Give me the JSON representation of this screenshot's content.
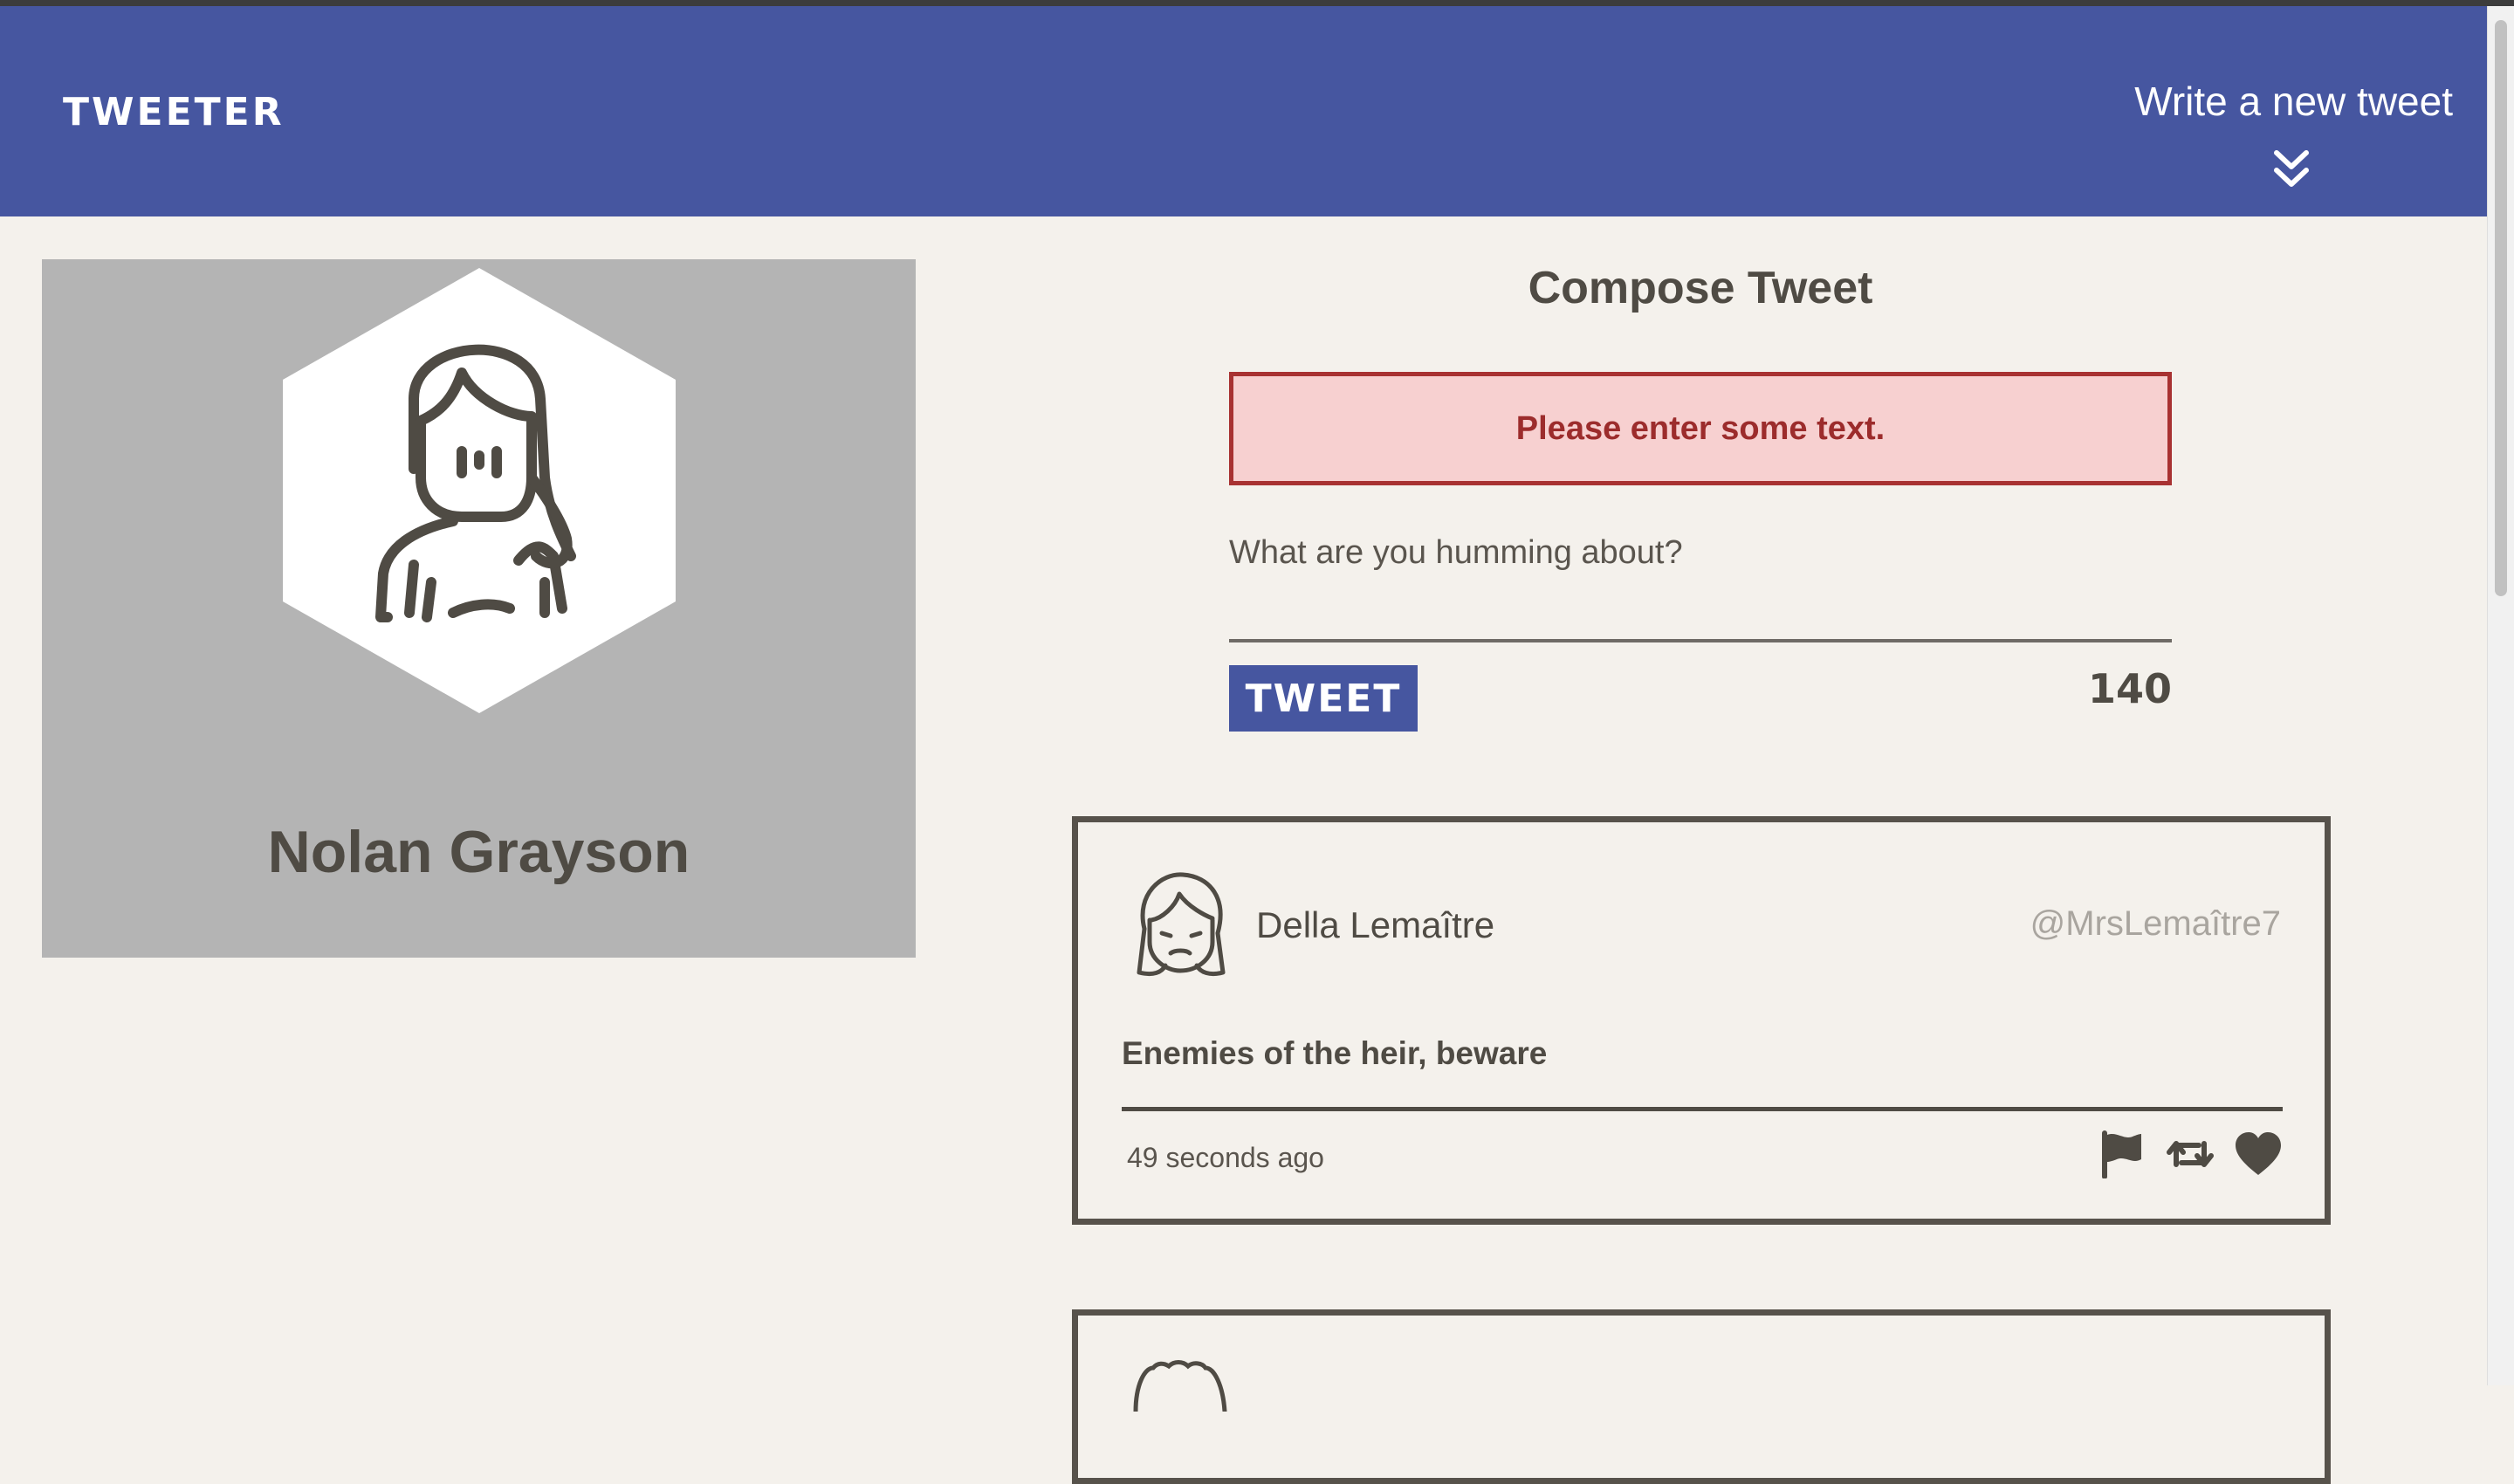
{
  "nav": {
    "brand": "TWEETER",
    "compose_toggle_label": "Write a new tweet",
    "toggle_icon": "double-chevron-down-icon"
  },
  "profile": {
    "name": "Nolan Grayson",
    "avatar_icon": "user-avatar-icon"
  },
  "compose": {
    "title": "Compose Tweet",
    "error": "Please enter some text.",
    "placeholder": "What are you humming about?",
    "value": "",
    "submit_label": "TWEET",
    "char_count": "140"
  },
  "tweets": [
    {
      "author": "Della Lemaître",
      "handle": "@MrsLemaître7",
      "body": "Enemies of the heir, beware",
      "time": "49 seconds ago",
      "actions": [
        "flag-icon",
        "retweet-icon",
        "heart-icon"
      ]
    }
  ],
  "colors": {
    "nav_bg": "#4656a0",
    "page_bg": "#f4f1ec",
    "profile_bg": "#b4b4b4",
    "error_bg": "#f7d0d0",
    "error_border": "#a83232",
    "text": "#4f4b44"
  }
}
